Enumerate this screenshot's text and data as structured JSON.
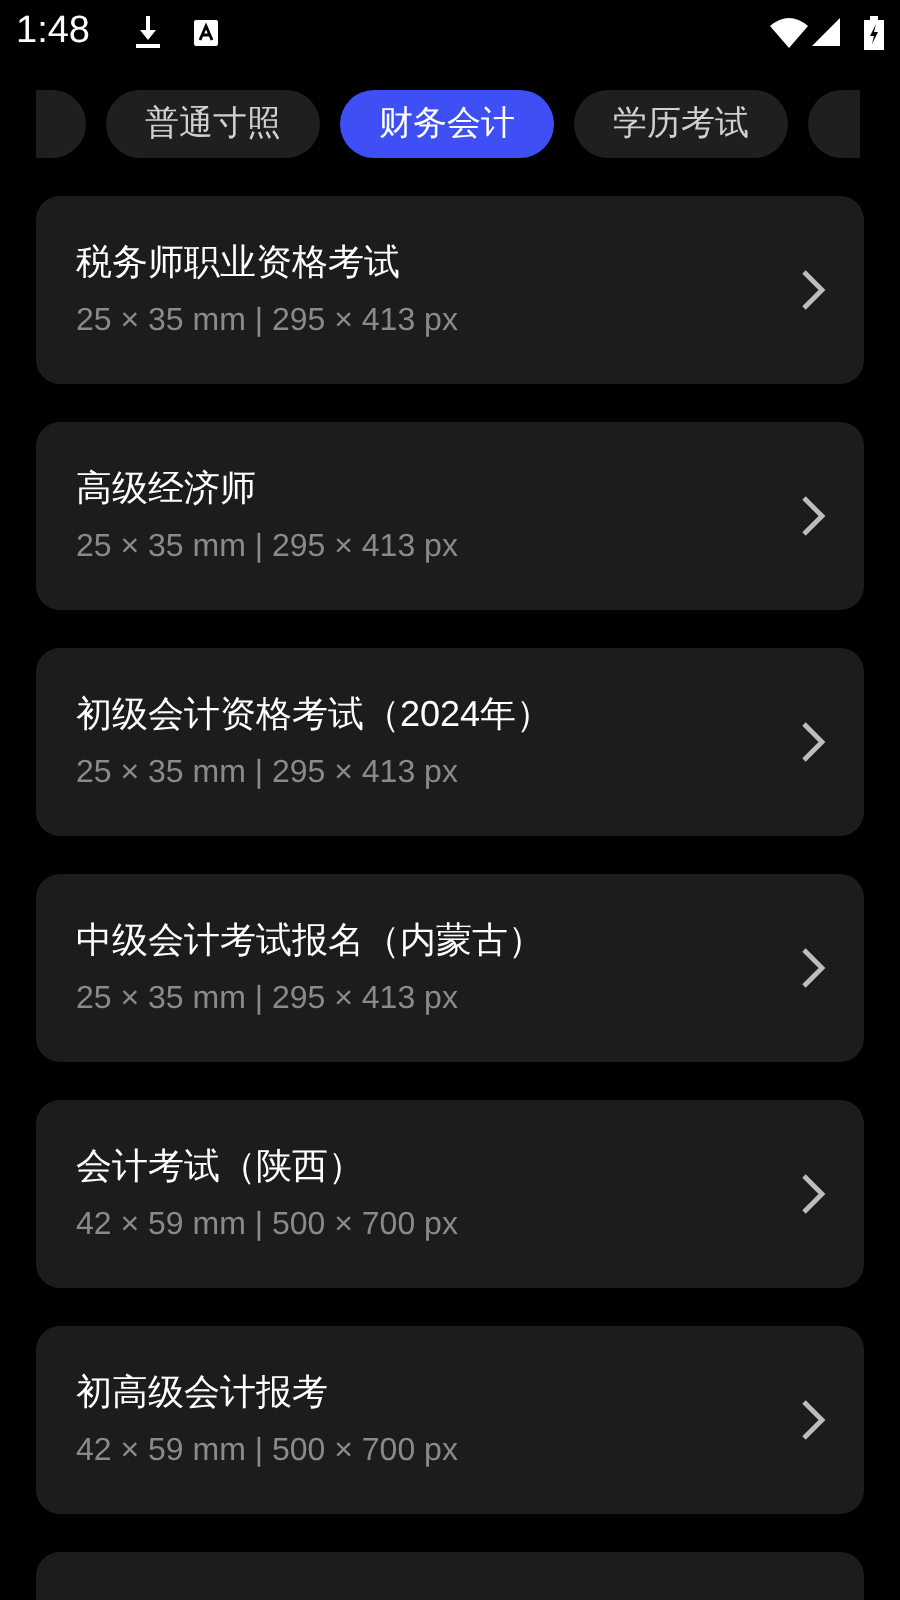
{
  "status_bar": {
    "time": "1:48"
  },
  "tabs": [
    {
      "label": "普通寸照",
      "selected": false
    },
    {
      "label": "财务会计",
      "selected": true
    },
    {
      "label": "学历考试",
      "selected": false
    }
  ],
  "items": [
    {
      "title": "税务师职业资格考试",
      "size": "25 × 35 mm | 295 × 413 px"
    },
    {
      "title": "高级经济师",
      "size": "25 × 35 mm | 295 × 413 px"
    },
    {
      "title": "初级会计资格考试（2024年）",
      "size": "25 × 35 mm | 295 × 413 px"
    },
    {
      "title": "中级会计考试报名（内蒙古）",
      "size": "25 × 35 mm | 295 × 413 px"
    },
    {
      "title": "会计考试（陕西）",
      "size": "42 × 59 mm | 500 × 700 px"
    },
    {
      "title": "初高级会计报考",
      "size": "42 × 59 mm | 500 × 700 px"
    }
  ]
}
